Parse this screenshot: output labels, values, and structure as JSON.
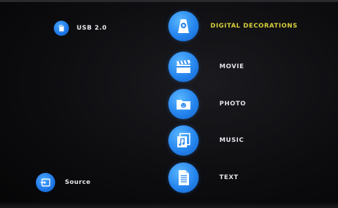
{
  "colors": {
    "accent_blue": "#1e77e6",
    "selected_label": "#d8cf3a",
    "label": "#e4e4e8",
    "background": "#0d0d10"
  },
  "left_panel": {
    "usb": {
      "label": "USB 2.0",
      "icon": "usb-drive-icon"
    },
    "source": {
      "label": "Source",
      "icon": "input-source-icon"
    }
  },
  "menu": {
    "selected_index": 0,
    "items": [
      {
        "label": "DIGITAL DECORATIONS",
        "icon": "digital-decorations-icon",
        "selected": true
      },
      {
        "label": "MOVIE",
        "icon": "clapperboard-icon",
        "selected": false
      },
      {
        "label": "PHOTO",
        "icon": "photo-folder-icon",
        "selected": false
      },
      {
        "label": "MUSIC",
        "icon": "music-note-icon",
        "selected": false
      },
      {
        "label": "TEXT",
        "icon": "text-document-icon",
        "selected": false
      }
    ]
  }
}
